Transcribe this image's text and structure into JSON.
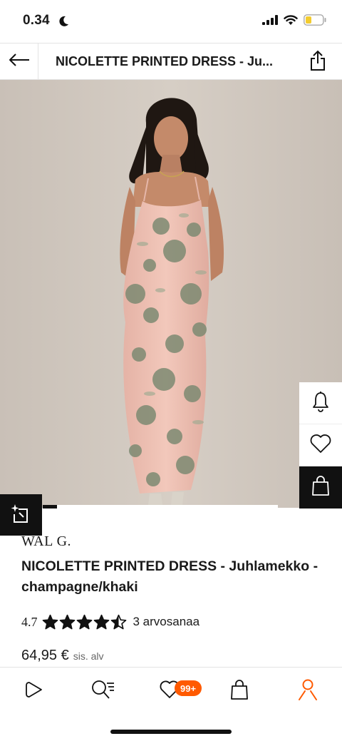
{
  "status_bar": {
    "time": "0.34"
  },
  "header": {
    "title": "NICOLETTE PRINTED DRESS - Ju...",
    "back_icon": "arrow-left-icon",
    "share_icon": "share-icon"
  },
  "gallery": {
    "image_alt": "Model wearing a pink floral satin slip dress",
    "progress_fraction": 0.06
  },
  "side_actions": [
    {
      "name": "notify",
      "icon": "bell-icon"
    },
    {
      "name": "wishlist",
      "icon": "heart-icon"
    },
    {
      "name": "add-to-bag",
      "icon": "bag-icon"
    }
  ],
  "product": {
    "brand": "WAL G.",
    "title": "NICOLETTE PRINTED DRESS - Juhlamekko - champagne/khaki",
    "rating": "4.7",
    "rating_stars": 4.5,
    "rating_count": "3 arvosanaa",
    "price": "64,95 €",
    "tax_note": "sis. alv"
  },
  "bottom_nav": {
    "items": [
      {
        "name": "home",
        "icon": "play-icon"
      },
      {
        "name": "search",
        "icon": "search-icon"
      },
      {
        "name": "wishlist",
        "icon": "heart-icon"
      },
      {
        "name": "bag",
        "icon": "bag-icon"
      },
      {
        "name": "account",
        "icon": "user-icon"
      }
    ],
    "wishlist_badge": "99+"
  },
  "colors": {
    "accent": "#ff5a00",
    "dark": "#111111",
    "dress_pink": "#efc1b4",
    "floral": "#7d8a72",
    "background": "#cfc6bd"
  }
}
